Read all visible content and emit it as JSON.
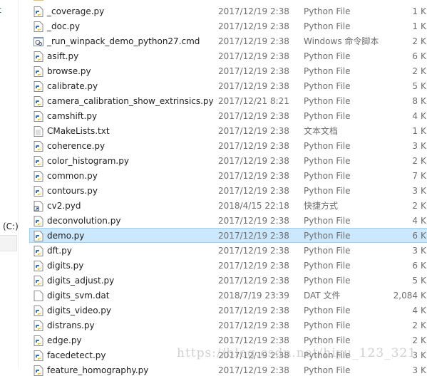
{
  "nav": {
    "partial_label": "t",
    "drive_label": "(C:)"
  },
  "files": [
    {
      "name": "",
      "date": "",
      "type": "",
      "size": "",
      "icon": "folder-icon"
    },
    {
      "name": "_coverage.py",
      "date": "2017/12/19 2:38",
      "type": "Python File",
      "size": "1",
      "icon": "python-file-icon"
    },
    {
      "name": "_doc.py",
      "date": "2017/12/19 2:38",
      "type": "Python File",
      "size": "1",
      "icon": "python-file-icon"
    },
    {
      "name": "_run_winpack_demo_python27.cmd",
      "date": "2017/12/19 2:38",
      "type": "Windows 命令脚本",
      "size": "2",
      "icon": "cmd-file-icon"
    },
    {
      "name": "asift.py",
      "date": "2017/12/19 2:38",
      "type": "Python File",
      "size": "6",
      "icon": "python-file-icon"
    },
    {
      "name": "browse.py",
      "date": "2017/12/19 2:38",
      "type": "Python File",
      "size": "2",
      "icon": "python-file-icon"
    },
    {
      "name": "calibrate.py",
      "date": "2017/12/19 2:38",
      "type": "Python File",
      "size": "5",
      "icon": "python-file-icon"
    },
    {
      "name": "camera_calibration_show_extrinsics.py",
      "date": "2017/12/21 8:21",
      "type": "Python File",
      "size": "8",
      "icon": "python-file-icon"
    },
    {
      "name": "camshift.py",
      "date": "2017/12/19 2:38",
      "type": "Python File",
      "size": "4",
      "icon": "python-file-icon"
    },
    {
      "name": "CMakeLists.txt",
      "date": "2017/12/19 2:38",
      "type": "文本文档",
      "size": "1",
      "icon": "text-file-icon"
    },
    {
      "name": "coherence.py",
      "date": "2017/12/19 2:38",
      "type": "Python File",
      "size": "3",
      "icon": "python-file-icon"
    },
    {
      "name": "color_histogram.py",
      "date": "2017/12/19 2:38",
      "type": "Python File",
      "size": "2",
      "icon": "python-file-icon"
    },
    {
      "name": "common.py",
      "date": "2017/12/19 2:38",
      "type": "Python File",
      "size": "7",
      "icon": "python-file-icon"
    },
    {
      "name": "contours.py",
      "date": "2017/12/19 2:38",
      "type": "Python File",
      "size": "3",
      "icon": "python-file-icon"
    },
    {
      "name": "cv2.pyd",
      "date": "2018/4/15 22:18",
      "type": "快捷方式",
      "size": "2",
      "icon": "shortcut-icon"
    },
    {
      "name": "deconvolution.py",
      "date": "2017/12/19 2:38",
      "type": "Python File",
      "size": "4",
      "icon": "python-file-icon"
    },
    {
      "name": "demo.py",
      "date": "2017/12/19 2:38",
      "type": "Python File",
      "size": "6",
      "icon": "python-file-icon",
      "selected": true
    },
    {
      "name": "dft.py",
      "date": "2017/12/19 2:38",
      "type": "Python File",
      "size": "3",
      "icon": "python-file-icon"
    },
    {
      "name": "digits.py",
      "date": "2017/12/19 2:38",
      "type": "Python File",
      "size": "6",
      "icon": "python-file-icon"
    },
    {
      "name": "digits_adjust.py",
      "date": "2017/12/19 2:38",
      "type": "Python File",
      "size": "5",
      "icon": "python-file-icon"
    },
    {
      "name": "digits_svm.dat",
      "date": "2018/7/19 23:39",
      "type": "DAT 文件",
      "size": "2,084",
      "icon": "blank-file-icon"
    },
    {
      "name": "digits_video.py",
      "date": "2017/12/19 2:38",
      "type": "Python File",
      "size": "4",
      "icon": "python-file-icon"
    },
    {
      "name": "distrans.py",
      "date": "2017/12/19 2:38",
      "type": "Python File",
      "size": "2",
      "icon": "python-file-icon"
    },
    {
      "name": "edge.py",
      "date": "2017/12/19 2:38",
      "type": "Python File",
      "size": "2",
      "icon": "python-file-icon"
    },
    {
      "name": "facedetect.py",
      "date": "2017/12/19 2:38",
      "type": "Python File",
      "size": "3",
      "icon": "python-file-icon"
    },
    {
      "name": "feature_homography.py",
      "date": "2017/12/19 2:38",
      "type": "Python File",
      "size": "3",
      "icon": "python-file-icon"
    }
  ],
  "size_unit": "K",
  "watermark": "https://blog.csdn.net/hiyu_123_321"
}
